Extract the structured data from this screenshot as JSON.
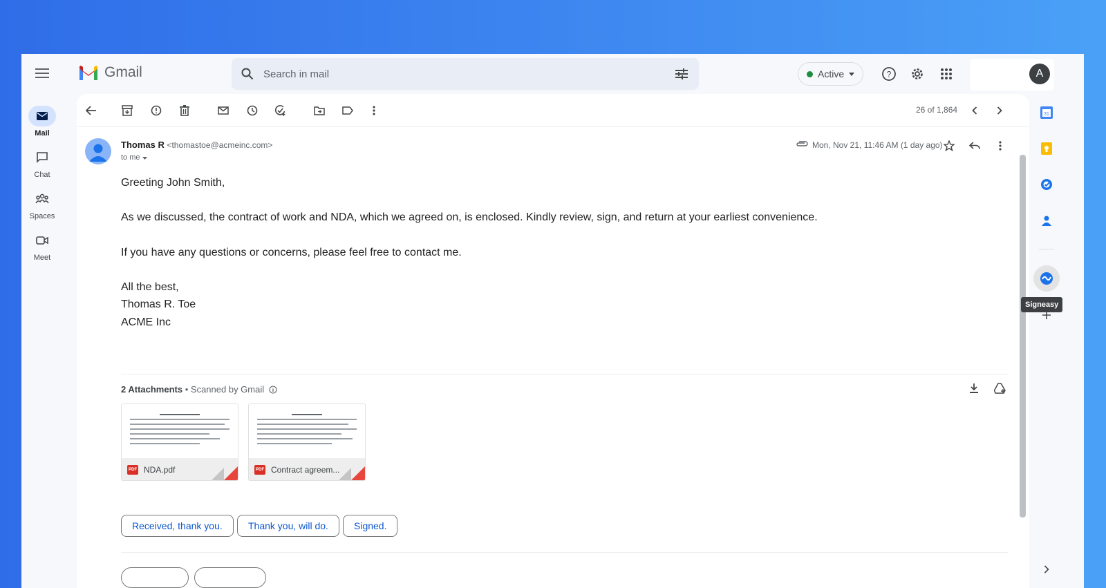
{
  "header": {
    "app_name": "Gmail",
    "search_placeholder": "Search in mail",
    "status_label": "Active",
    "avatar_letter": "A"
  },
  "nav": {
    "items": [
      {
        "label": "Mail",
        "icon": "mail-icon",
        "active": true
      },
      {
        "label": "Chat",
        "icon": "chat-icon"
      },
      {
        "label": "Spaces",
        "icon": "spaces-icon"
      },
      {
        "label": "Meet",
        "icon": "meet-icon"
      }
    ]
  },
  "toolbar": {
    "count": "26 of 1,864"
  },
  "message": {
    "sender_name": "Thomas R",
    "sender_email": "<thomastoe@acmeinc.com>",
    "to_label": "to me",
    "date": "Mon, Nov 21, 11:46 AM (1 day ago)",
    "greeting": "Greeting John Smith,",
    "paragraph1": "As we discussed, the contract of work and NDA, which we agreed on, is enclosed. Kindly review, sign, and return at your earliest convenience.",
    "paragraph2": "If you have any questions or concerns, please feel free to contact me.",
    "closing": "All the best,",
    "signature_name": "Thomas R. Toe",
    "signature_company": "ACME Inc"
  },
  "attachments": {
    "title": "2 Attachments",
    "scanned": "Scanned by Gmail",
    "files": [
      {
        "name": "NDA.pdf",
        "type": "PDF"
      },
      {
        "name": "Contract agreem...",
        "type": "PDF"
      }
    ]
  },
  "smart_replies": [
    "Received, thank you.",
    "Thank you, will do.",
    "Signed."
  ],
  "side_panel": {
    "tooltip": "Signeasy"
  },
  "colors": {
    "accent": "#0b57d0",
    "active_nav": "#d3e3fd",
    "status_green": "#1e8e3e",
    "pdf_red": "#d93025"
  }
}
